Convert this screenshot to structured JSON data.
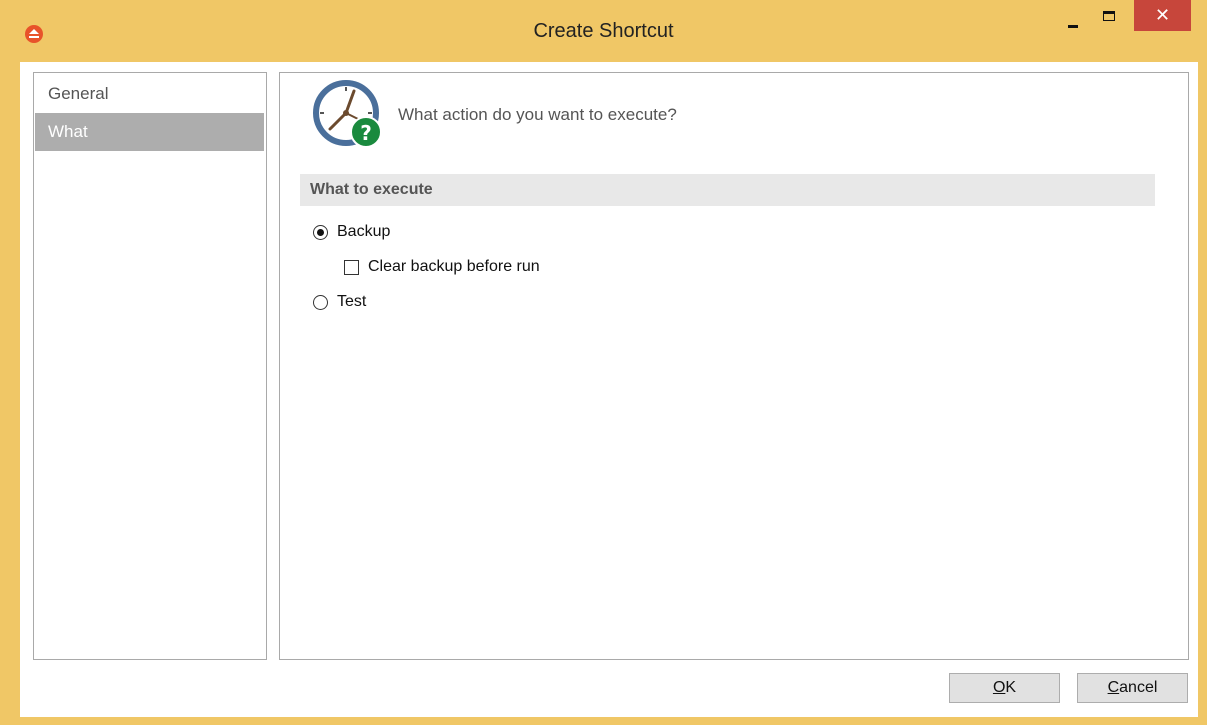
{
  "window": {
    "title": "Create Shortcut",
    "close_glyph": "✕"
  },
  "nav": {
    "items": [
      {
        "label": "General",
        "selected": false
      },
      {
        "label": "What",
        "selected": true
      }
    ]
  },
  "header": {
    "question": "What action do you want to execute?",
    "icon": "clock-question-icon"
  },
  "section": {
    "title": "What to execute"
  },
  "options": {
    "backup_label": "Backup",
    "backup_selected": true,
    "clear_backup_label": "Clear backup before run",
    "clear_backup_checked": false,
    "test_label": "Test",
    "test_selected": false
  },
  "buttons": {
    "ok": {
      "label": "OK",
      "mnemonic": "O"
    },
    "cancel": {
      "label": "Cancel",
      "mnemonic": "C"
    }
  },
  "colors": {
    "titlebar": "#f0c766",
    "close": "#c7463b",
    "nav_selected": "#adadad",
    "section_bar": "#e8e8e8",
    "icon_badge": "#1a8a3e"
  }
}
